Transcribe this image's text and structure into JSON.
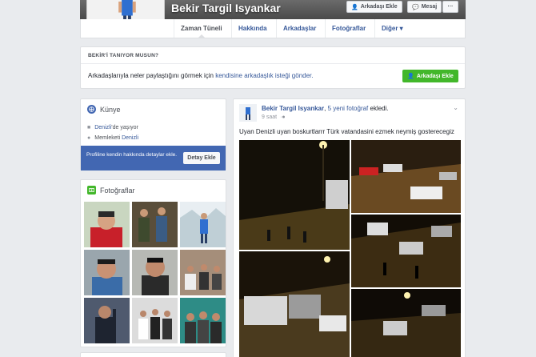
{
  "profile": {
    "name": "Bekir Targil Isyankar",
    "add_friend_label": "Arkadaşı Ekle",
    "message_label": "Mesaj",
    "more_label": "···"
  },
  "nav": {
    "tabs": [
      {
        "label": "Zaman Tüneli"
      },
      {
        "label": "Hakkında"
      },
      {
        "label": "Arkadaşlar"
      },
      {
        "label": "Fotoğraflar"
      },
      {
        "label": "Diğer ▾"
      }
    ]
  },
  "know": {
    "title": "BEKİR'İ TANIYOR MUSUN?",
    "text_before": "Arkadaşlarıyla neler paylaştığını görmek için ",
    "text_link": "kendisine arkadaşlık isteği gönder.",
    "button_label": "Arkadaşı Ekle"
  },
  "intro": {
    "title": "Künye",
    "lives_prefix": "Denizli",
    "lives_suffix": "'de yaşıyor",
    "hometown_prefix": "Memleketi ",
    "hometown_link": "Denizli",
    "prompt": "Profiline kendin hakkında detaylar ekle.",
    "button_label": "Detay Ekle"
  },
  "photos": {
    "title": "Fotoğraflar"
  },
  "post": {
    "author": "Bekir Targil Isyankar",
    "action_prefix": ", ",
    "action_link": "5 yeni fotoğraf",
    "action_suffix": " ekledi.",
    "time": "9 saat",
    "text": "Uyan Denizli uyan boskurtlarrr Türk vatandasini ezmek neymiş gosterecegiz"
  },
  "colors": {
    "link": "#365899",
    "primary": "#4267b2",
    "green": "#42b72a"
  }
}
